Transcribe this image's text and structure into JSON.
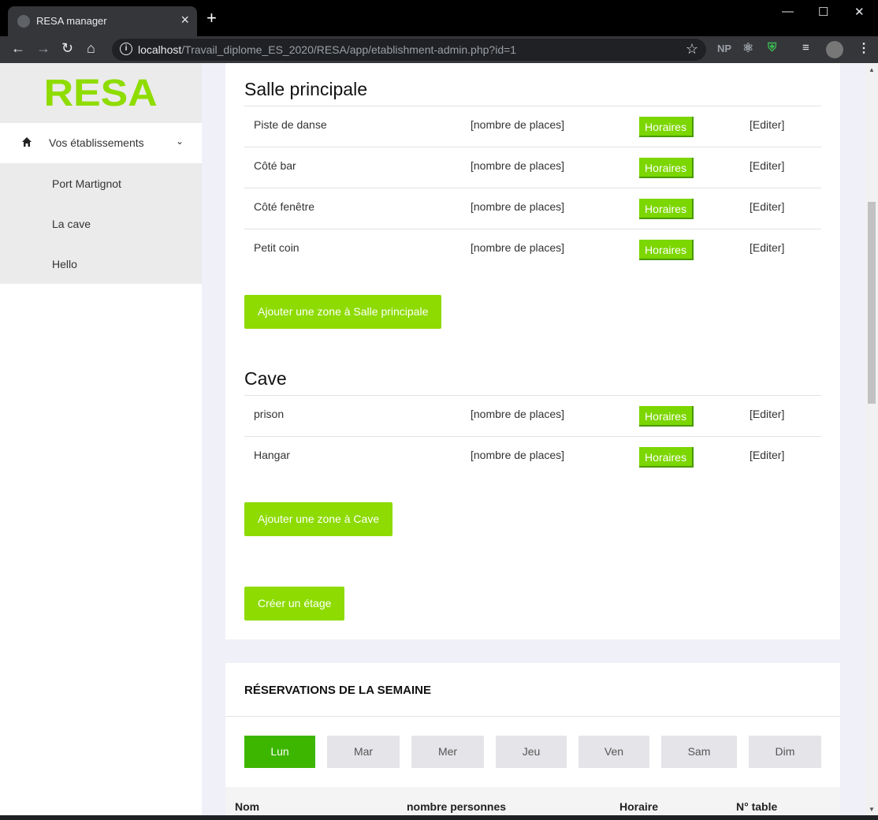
{
  "browser": {
    "tab_title": "RESA manager",
    "url_host": "localhost",
    "url_path": "/Travail_diplome_ES_2020/RESA/app/etablishment-admin.php?id=1",
    "extension_np": "NP"
  },
  "sidebar": {
    "logo": "RESA",
    "menu_label": "Vos établissements",
    "items": [
      {
        "label": "Port Martignot"
      },
      {
        "label": "La cave"
      },
      {
        "label": "Hello"
      }
    ]
  },
  "floors": [
    {
      "title": "Salle principale",
      "zones": [
        {
          "name": "Piste de danse",
          "places": "[nombre de places]",
          "schedule_label": "Horaires",
          "edit_label": "[Editer]"
        },
        {
          "name": "Côté bar",
          "places": "[nombre de places]",
          "schedule_label": "Horaires",
          "edit_label": "[Editer]"
        },
        {
          "name": "Côté fenêtre",
          "places": "[nombre de places]",
          "schedule_label": "Horaires",
          "edit_label": "[Editer]"
        },
        {
          "name": "Petit coin",
          "places": "[nombre de places]",
          "schedule_label": "Horaires",
          "edit_label": "[Editer]"
        }
      ],
      "add_zone_label": "Ajouter une zone à Salle principale"
    },
    {
      "title": "Cave",
      "zones": [
        {
          "name": "prison",
          "places": "[nombre de places]",
          "schedule_label": "Horaires",
          "edit_label": "[Editer]"
        },
        {
          "name": "Hangar",
          "places": "[nombre de places]",
          "schedule_label": "Horaires",
          "edit_label": "[Editer]"
        }
      ],
      "add_zone_label": "Ajouter une zone à Cave"
    }
  ],
  "create_floor_label": "Créer un étage",
  "reservations": {
    "heading": "RÉSERVATIONS DE LA SEMAINE",
    "days": [
      "Lun",
      "Mar",
      "Mer",
      "Jeu",
      "Ven",
      "Sam",
      "Dim"
    ],
    "active_day": "Lun",
    "columns": [
      "Nom",
      "nombre personnes",
      "Horaire",
      "N° table"
    ]
  },
  "colors": {
    "accent": "#8ddb00",
    "active_day": "#3db600",
    "page_bg": "#eff0f8"
  }
}
